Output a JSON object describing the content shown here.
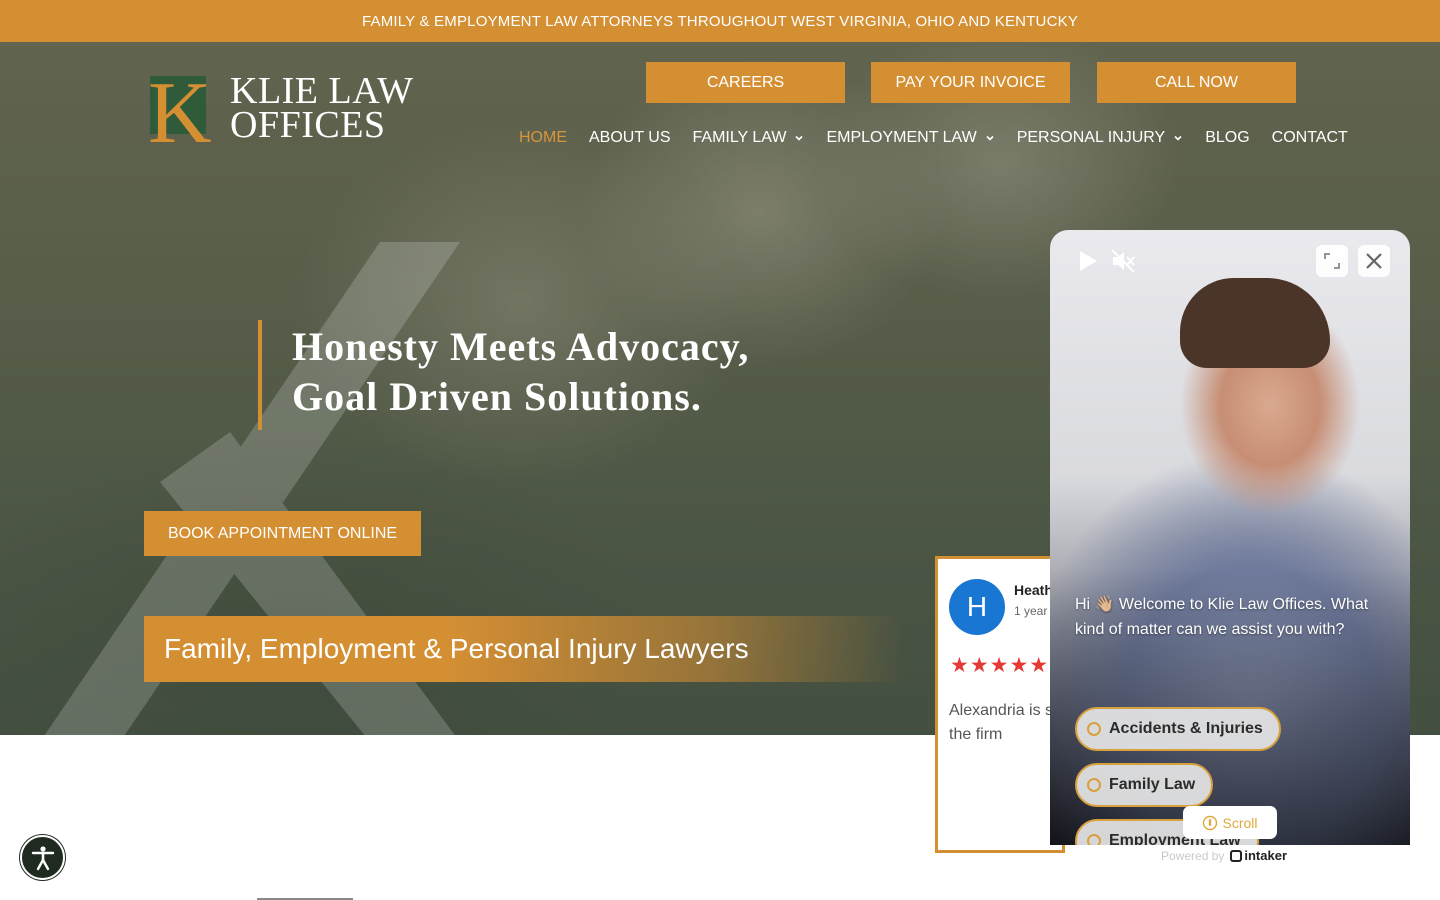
{
  "topbar": {
    "text": "FAMILY & EMPLOYMENT LAW ATTORNEYS THROUGHOUT WEST VIRGINIA, OHIO AND KENTUCKY"
  },
  "logo": {
    "line1": "KLIE LAW",
    "line2": "OFFICES",
    "letter": "K"
  },
  "header_buttons": {
    "careers": "CAREERS",
    "pay_invoice": "PAY YOUR INVOICE",
    "call_now": "CALL NOW"
  },
  "nav": {
    "home": "HOME",
    "about": "ABOUT US",
    "family_law": "FAMILY LAW",
    "employment_law": "EMPLOYMENT LAW",
    "personal_injury": "PERSONAL INJURY",
    "blog": "BLOG",
    "contact": "CONTACT"
  },
  "hero": {
    "headline_line1": "Honesty Meets Advocacy,",
    "headline_line2": "Goal Driven Solutions.",
    "book_button": "BOOK APPOINTMENT ONLINE",
    "tagline": "Family, Employment & Personal Injury Lawyers"
  },
  "review": {
    "avatar_letter": "H",
    "name": "Heath",
    "time": "1 year",
    "stars": "★★★★★",
    "text": "Alexandria is s on the phone I call the firm"
  },
  "widget": {
    "message": "Hi 👋🏼 Welcome to Klie Law Offices. What kind of matter can we assist you with?",
    "options": [
      "Accidents & Injuries",
      "Family Law",
      "Employment Law"
    ],
    "scroll_label": "Scroll",
    "powered_by": "Powered by",
    "brand": "intaker"
  },
  "colors": {
    "accent": "#D58F33",
    "review_avatar": "#1976D2",
    "stars": "#E53935"
  },
  "icons": [
    "play-icon",
    "mute-icon",
    "expand-icon",
    "close-icon",
    "chevron-down-icon",
    "accessibility-icon",
    "hand-icon"
  ]
}
